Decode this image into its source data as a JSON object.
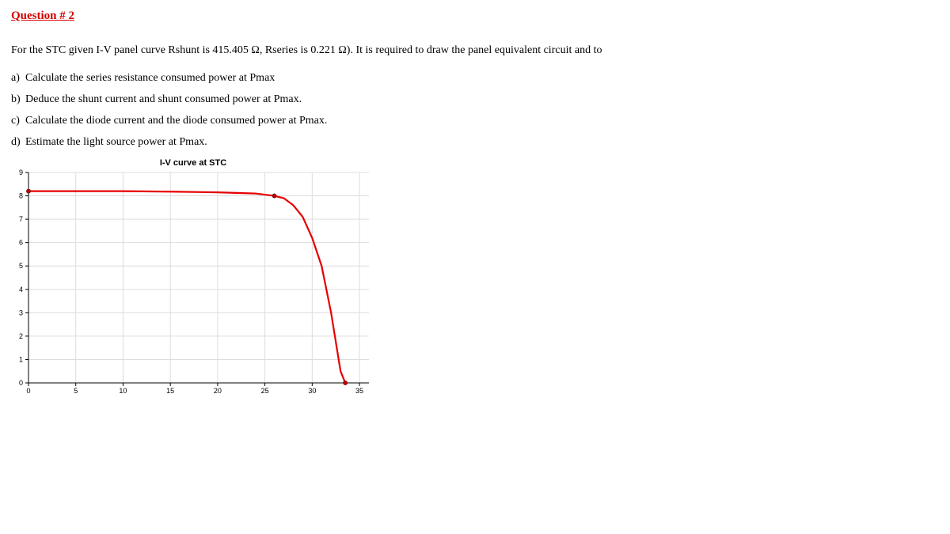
{
  "title": "Question # 2",
  "intro": "For the STC given I-V panel curve Rshunt is 415.405  Ω, Rseries is 0.221 Ω). It is required to draw the panel equivalent circuit and to",
  "items": {
    "a": "Calculate the series resistance consumed power at Pmax",
    "b": "Deduce the shunt current and shunt consumed power at Pmax.",
    "c": "Calculate the diode current and the diode consumed power at Pmax.",
    "d": "Estimate the light source power at Pmax."
  },
  "chart_data": {
    "type": "line",
    "title": "I-V curve at STC",
    "xlabel": "",
    "ylabel": "",
    "xlim": [
      0,
      36
    ],
    "ylim": [
      0,
      9
    ],
    "xticks": [
      0,
      5,
      10,
      15,
      20,
      25,
      30,
      35
    ],
    "yticks": [
      0,
      1,
      2,
      3,
      4,
      5,
      6,
      7,
      8,
      9
    ],
    "series": [
      {
        "name": "I-V",
        "x": [
          0,
          5,
          10,
          15,
          20,
          24,
          25,
          26,
          27,
          28,
          29,
          30,
          31,
          32,
          33,
          33.5
        ],
        "values": [
          8.2,
          8.2,
          8.2,
          8.18,
          8.15,
          8.1,
          8.05,
          8.0,
          7.9,
          7.6,
          7.1,
          6.2,
          5.0,
          3.0,
          0.5,
          0
        ]
      }
    ],
    "markers": [
      {
        "x": 0,
        "y": 8.2
      },
      {
        "x": 26,
        "y": 8.0
      },
      {
        "x": 33.5,
        "y": 0
      }
    ]
  }
}
